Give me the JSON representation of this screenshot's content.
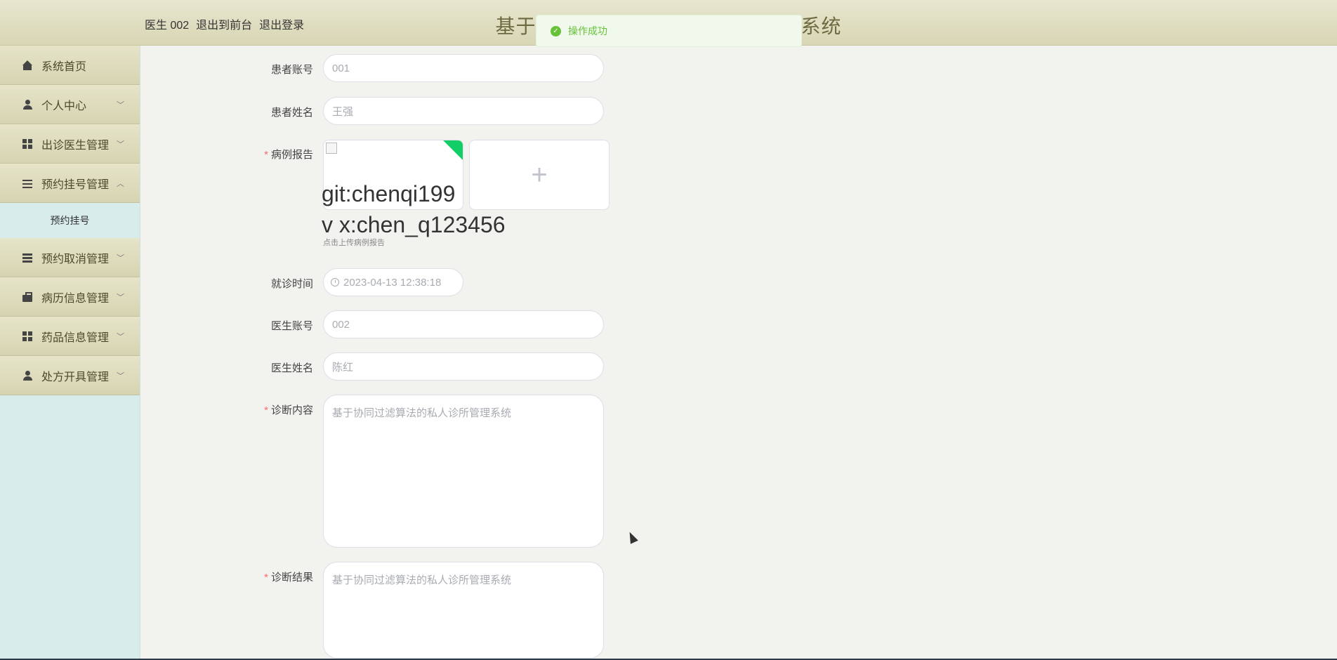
{
  "header": {
    "user": "医生 002",
    "to_front": "退出到前台",
    "logout": "退出登录",
    "app_title": "基于协同过滤算法的私人诊所管理系统"
  },
  "toast": {
    "message": "操作成功",
    "color": "#67c23a"
  },
  "sidebar": {
    "items": [
      {
        "label": "系统首页",
        "icon": "home-icon"
      },
      {
        "label": "个人中心",
        "icon": "person-icon"
      },
      {
        "label": "出诊医生管理",
        "icon": "grid-icon"
      },
      {
        "label": "预约挂号管理",
        "icon": "sliders-icon"
      },
      {
        "label": "预约取消管理",
        "icon": "list-icon"
      },
      {
        "label": "病历信息管理",
        "icon": "briefcase-icon"
      },
      {
        "label": "药品信息管理",
        "icon": "grid-icon"
      },
      {
        "label": "处方开具管理",
        "icon": "person-icon"
      }
    ],
    "submenu": {
      "label": "预约挂号"
    }
  },
  "form": {
    "patient_account": {
      "label": "患者账号",
      "value": "001"
    },
    "patient_name": {
      "label": "患者姓名",
      "value": "王强"
    },
    "case_report": {
      "label": "病例报告",
      "watermark_line1": "git:chenqi199",
      "watermark_line2": "v x:chen_q123456",
      "tip": "点击上传病例报告",
      "add": "+"
    },
    "visit_time": {
      "label": "就诊时间",
      "value": "2023-04-13 12:38:18"
    },
    "doctor_account": {
      "label": "医生账号",
      "value": "002"
    },
    "doctor_name": {
      "label": "医生姓名",
      "value": "陈红"
    },
    "diagnosis_content": {
      "label": "诊断内容",
      "placeholder": "基于协同过滤算法的私人诊所管理系统"
    },
    "diagnosis_result": {
      "label": "诊断结果",
      "placeholder": "基于协同过滤算法的私人诊所管理系统"
    }
  }
}
